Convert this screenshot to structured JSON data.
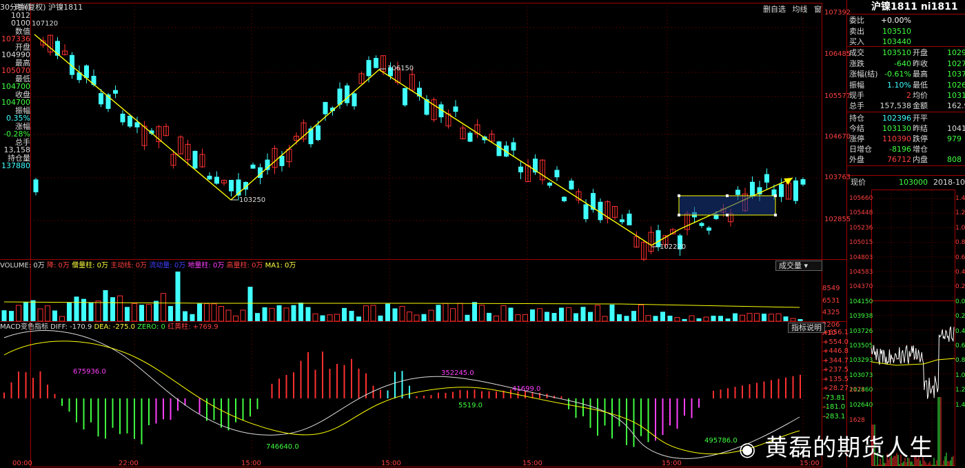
{
  "header": {
    "period": "30分钟(复权)",
    "symbol": "沪镍1811"
  },
  "toolbar": {
    "items": [
      "删自选",
      "均线",
      "窗"
    ]
  },
  "left_panel": [
    {
      "k": "时间",
      "v": "1012",
      "c": "#dcdcdc"
    },
    {
      "k": "",
      "v": "0100",
      "c": "#dcdcdc"
    },
    {
      "k": "数值",
      "v": "107336",
      "c": "#ff4040"
    },
    {
      "k": "开盘",
      "v": "104990",
      "c": "#dcdcdc"
    },
    {
      "k": "最高",
      "v": "105070",
      "c": "#ff4040"
    },
    {
      "k": "最低",
      "v": "104700",
      "c": "#40ff40"
    },
    {
      "k": "收盘",
      "v": "104700",
      "c": "#40ff40"
    },
    {
      "k": "振幅",
      "v": "0.35%",
      "c": "#40ffff"
    },
    {
      "k": "涨幅",
      "v": "-0.28%",
      "c": "#40ff40"
    },
    {
      "k": "总手",
      "v": "13,158",
      "c": "#dcdcdc"
    },
    {
      "k": "持仓量",
      "v": "137880",
      "c": "#40ffff"
    }
  ],
  "price_axis": [
    "107392",
    "106485",
    "105577",
    "104670",
    "103763",
    "102855"
  ],
  "annotations": {
    "high_start": "107120",
    "low1": "103250",
    "peak": "106150",
    "low2": "102220"
  },
  "volume_bar": {
    "title": "VOLUME: 0万",
    "items": [
      "降: 0万",
      "僧量柱: 0万",
      "主动线: 0万",
      "流动量: 0万",
      "地量柱: 0万",
      "高量柱: 0万",
      "MA1: 0万"
    ],
    "selector": "成交量"
  },
  "volume_axis": [
    "8549",
    "6531",
    "4325",
    "2206",
    "X10"
  ],
  "macd_bar": {
    "title": "MACD变色指标",
    "diff": "DIFF: -170.9",
    "dea": "DEA: -275.0",
    "zero": "ZERO: 0",
    "red": "红黄柱: +769.9",
    "button": "指标说明"
  },
  "macd_axis": [
    "+656.1",
    "+554.0",
    "+446.8",
    "+344.7",
    "+237.5",
    "+135.5",
    "+28.27",
    "-73.81",
    "-181.0",
    "-283.1"
  ],
  "macd_labels": [
    "675936.0",
    "352245.0",
    "41699.0",
    "5519.0",
    "746640.0",
    "495786.0"
  ],
  "time_axis": [
    "00:00",
    "22:00",
    "15:00",
    "15:00",
    "15:00",
    "15:00",
    "15:00"
  ],
  "quote": {
    "title": "沪镍1811 ni1811",
    "rows": [
      {
        "l1": "委比",
        "v1": "+0.00%",
        "c1": "#ffffff"
      },
      {
        "l1": "卖出",
        "v1": "103510",
        "c1": "#40ff40"
      },
      {
        "l1": "买入",
        "v1": "103440",
        "c1": "#40ff40"
      },
      {
        "l1": "成交",
        "v1": "103510",
        "c1": "#40ff40",
        "l2": "开盘",
        "v2": "1029",
        "c2": "#40ff40"
      },
      {
        "l1": "涨跌",
        "v1": "-640",
        "c1": "#40ff40",
        "l2": "昨收",
        "v2": "1027",
        "c2": "#40ff40"
      },
      {
        "l1": "涨幅(结)",
        "v1": "-0.61%",
        "c1": "#40ff40",
        "l2": "最高",
        "v2": "1037",
        "c2": "#40ff40"
      },
      {
        "l1": "振幅",
        "v1": "1.10%",
        "c1": "#40ffff",
        "l2": "最低",
        "v2": "1026",
        "c2": "#40ff40"
      },
      {
        "l1": "现手",
        "v1": "2",
        "c1": "#ff4040",
        "l2": "均价",
        "v2": "1031",
        "c2": "#40ff40"
      },
      {
        "l1": "总手",
        "v1": "157,538",
        "c1": "#dcdcdc",
        "l2": "金额",
        "v2": "162.9",
        "c2": "#dcdcdc"
      },
      {
        "l1": "持仓",
        "v1": "102396",
        "c1": "#40ffff",
        "l2": "开平",
        "v2": "",
        "c2": "#dcdcdc"
      },
      {
        "l1": "今结",
        "v1": "103130",
        "c1": "#40ff40",
        "l2": "昨结",
        "v2": "1041",
        "c2": "#dcdcdc"
      },
      {
        "l1": "涨停",
        "v1": "110390",
        "c1": "#ff4040",
        "l2": "跌停",
        "v2": "979",
        "c2": "#40ff40"
      },
      {
        "l1": "日增仓",
        "v1": "-8196",
        "c1": "#40ff40",
        "l2": "增仓",
        "v2": "",
        "c2": "#dcdcdc"
      },
      {
        "l1": "外盘",
        "v1": "76712",
        "c1": "#ff4040",
        "l2": "内盘",
        "v2": "808",
        "c2": "#40ff40"
      }
    ],
    "current_label": "现价",
    "current_value": "103000",
    "date": "2018-10-16"
  },
  "mini_axis_left": [
    "105660",
    "105448",
    "105236",
    "105015",
    "104803",
    "104583",
    "104370",
    "104150",
    "103938",
    "103726",
    "103505",
    "103293",
    "103073",
    "102860",
    "102640",
    "2171",
    "1628"
  ],
  "mini_axis_right": [
    "1.45",
    "1.25",
    "1.03",
    "0.83",
    "0.62",
    "0.42",
    "0.21",
    "0.00",
    "0.21",
    "0.42",
    "0.62",
    "0.83",
    "1.03",
    "1.24",
    "1.45"
  ],
  "watermark": "黄磊的期货人生",
  "colors": {
    "up": "#ff3030",
    "down": "#40ffff",
    "trend": "#ffff00",
    "grid": "#8b0000"
  }
}
